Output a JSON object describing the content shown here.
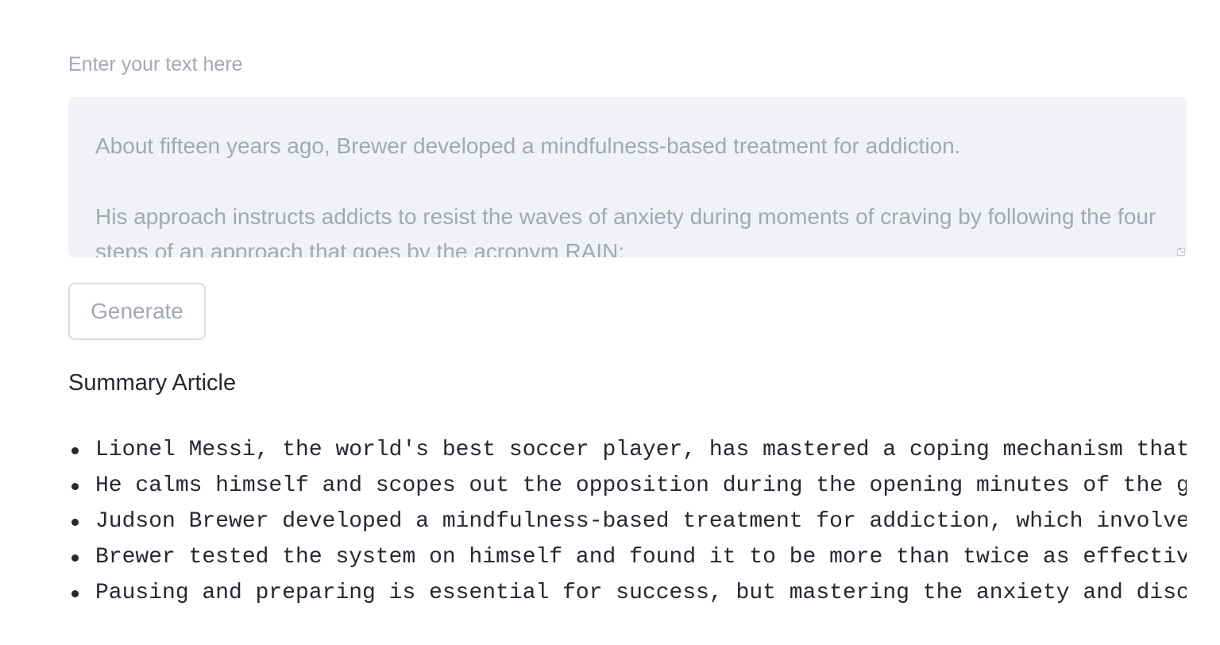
{
  "input": {
    "label": "Enter your text here",
    "paragraphs": [
      "About fifteen years ago, Brewer developed a mindfulness-based treatment for addiction.",
      "His approach instructs addicts to resist the waves of anxiety during moments of craving by following the four steps of an approach that goes by the acronym RAIN:"
    ]
  },
  "generate_button": {
    "label": "Generate"
  },
  "summary": {
    "title": "Summary Article",
    "bullets": [
      "Lionel Messi, the world's best soccer player, has mastered a coping mechanism that",
      "He calms himself and scopes out the opposition during the opening minutes of the g",
      "Judson Brewer developed a mindfulness-based treatment for addiction, which involve",
      "Brewer tested the system on himself and found it to be more than twice as effectiv",
      "Pausing and preparing is essential for success, but mastering the anxiety and disc"
    ]
  }
}
